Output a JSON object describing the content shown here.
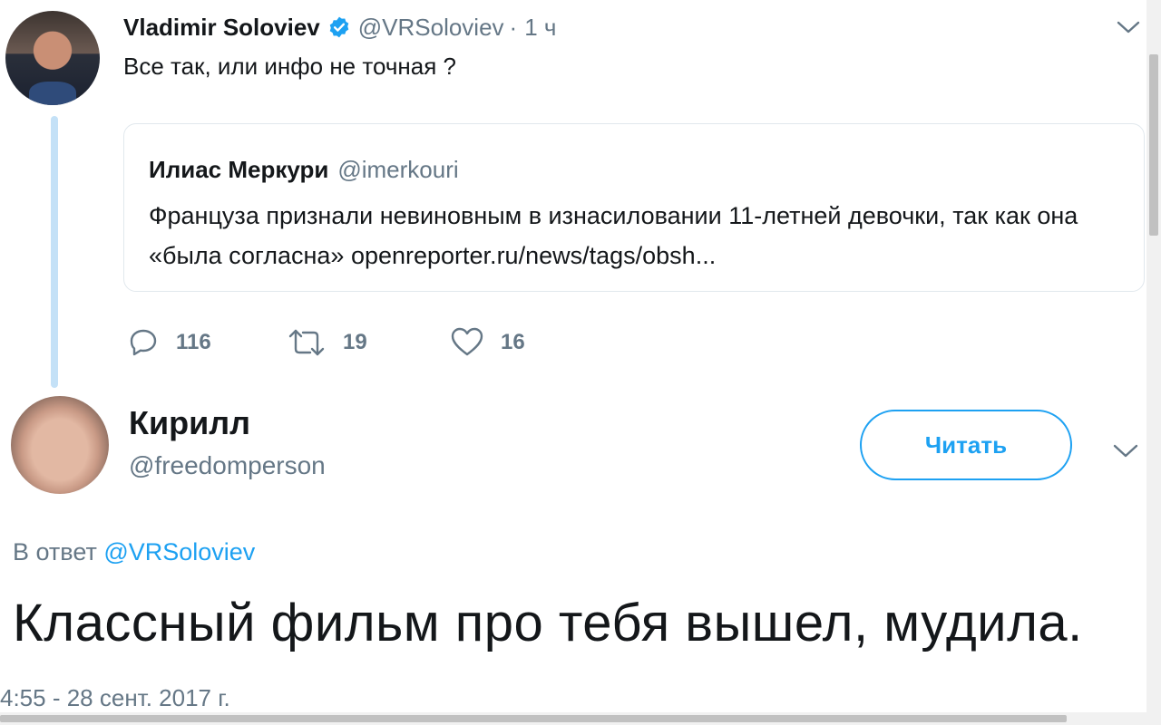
{
  "parent_tweet": {
    "author_name": "Vladimir Soloviev",
    "handle": "@VRSoloviev",
    "separator": "·",
    "time": "1 ч",
    "text": "Все так, или инфо не точная ?",
    "quoted": {
      "author_name": "Илиас Меркури",
      "handle": "@imerkouri",
      "text": "Француза признали невиновным в изнасиловании 11-летней девочки, так как она «была согласна» openreporter.ru/news/tags/obsh..."
    },
    "actions": {
      "replies": "116",
      "retweets": "19",
      "likes": "16"
    }
  },
  "reply": {
    "author_name": "Кирилл",
    "handle": "@freedomperson",
    "follow_label": "Читать",
    "replying_prefix": "В ответ ",
    "replying_mention": "@VRSoloviev",
    "text": "Классный фильм про тебя вышел, мудила.",
    "timestamp": "4:55 - 28 сент. 2017 г."
  },
  "colors": {
    "accent": "#1da1f2",
    "secondary_text": "#657786",
    "primary_text": "#14171a",
    "thread_line": "#c4e1f7",
    "border": "#e1e8ed"
  },
  "icons": [
    "verified-badge-icon",
    "chevron-down-icon",
    "reply-icon",
    "retweet-icon",
    "like-icon"
  ]
}
